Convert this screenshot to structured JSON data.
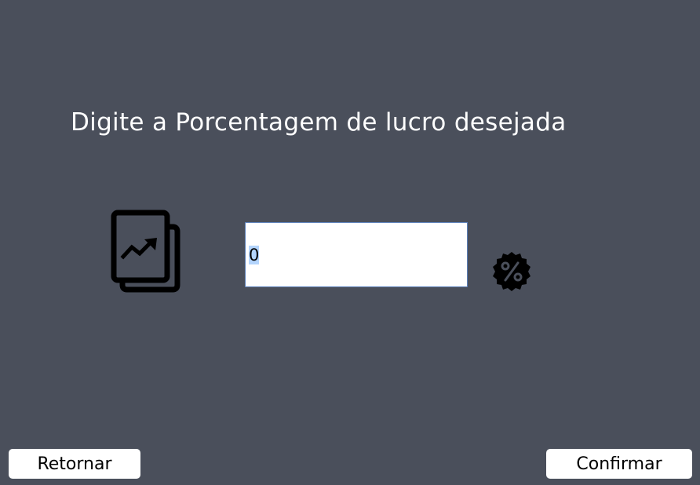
{
  "title": "Digite a Porcentagem de lucro desejada",
  "percentage_input": {
    "value": "0",
    "selected": true
  },
  "icons": {
    "chart": "stacked-trending-chart-icon",
    "percent": "percent-badge-icon"
  },
  "buttons": {
    "back_label": "Retornar",
    "confirm_label": "Confirmar"
  },
  "colors": {
    "background": "#4a4f5b",
    "input_border": "#5b7fb8",
    "selection": "#b3d4fc"
  }
}
